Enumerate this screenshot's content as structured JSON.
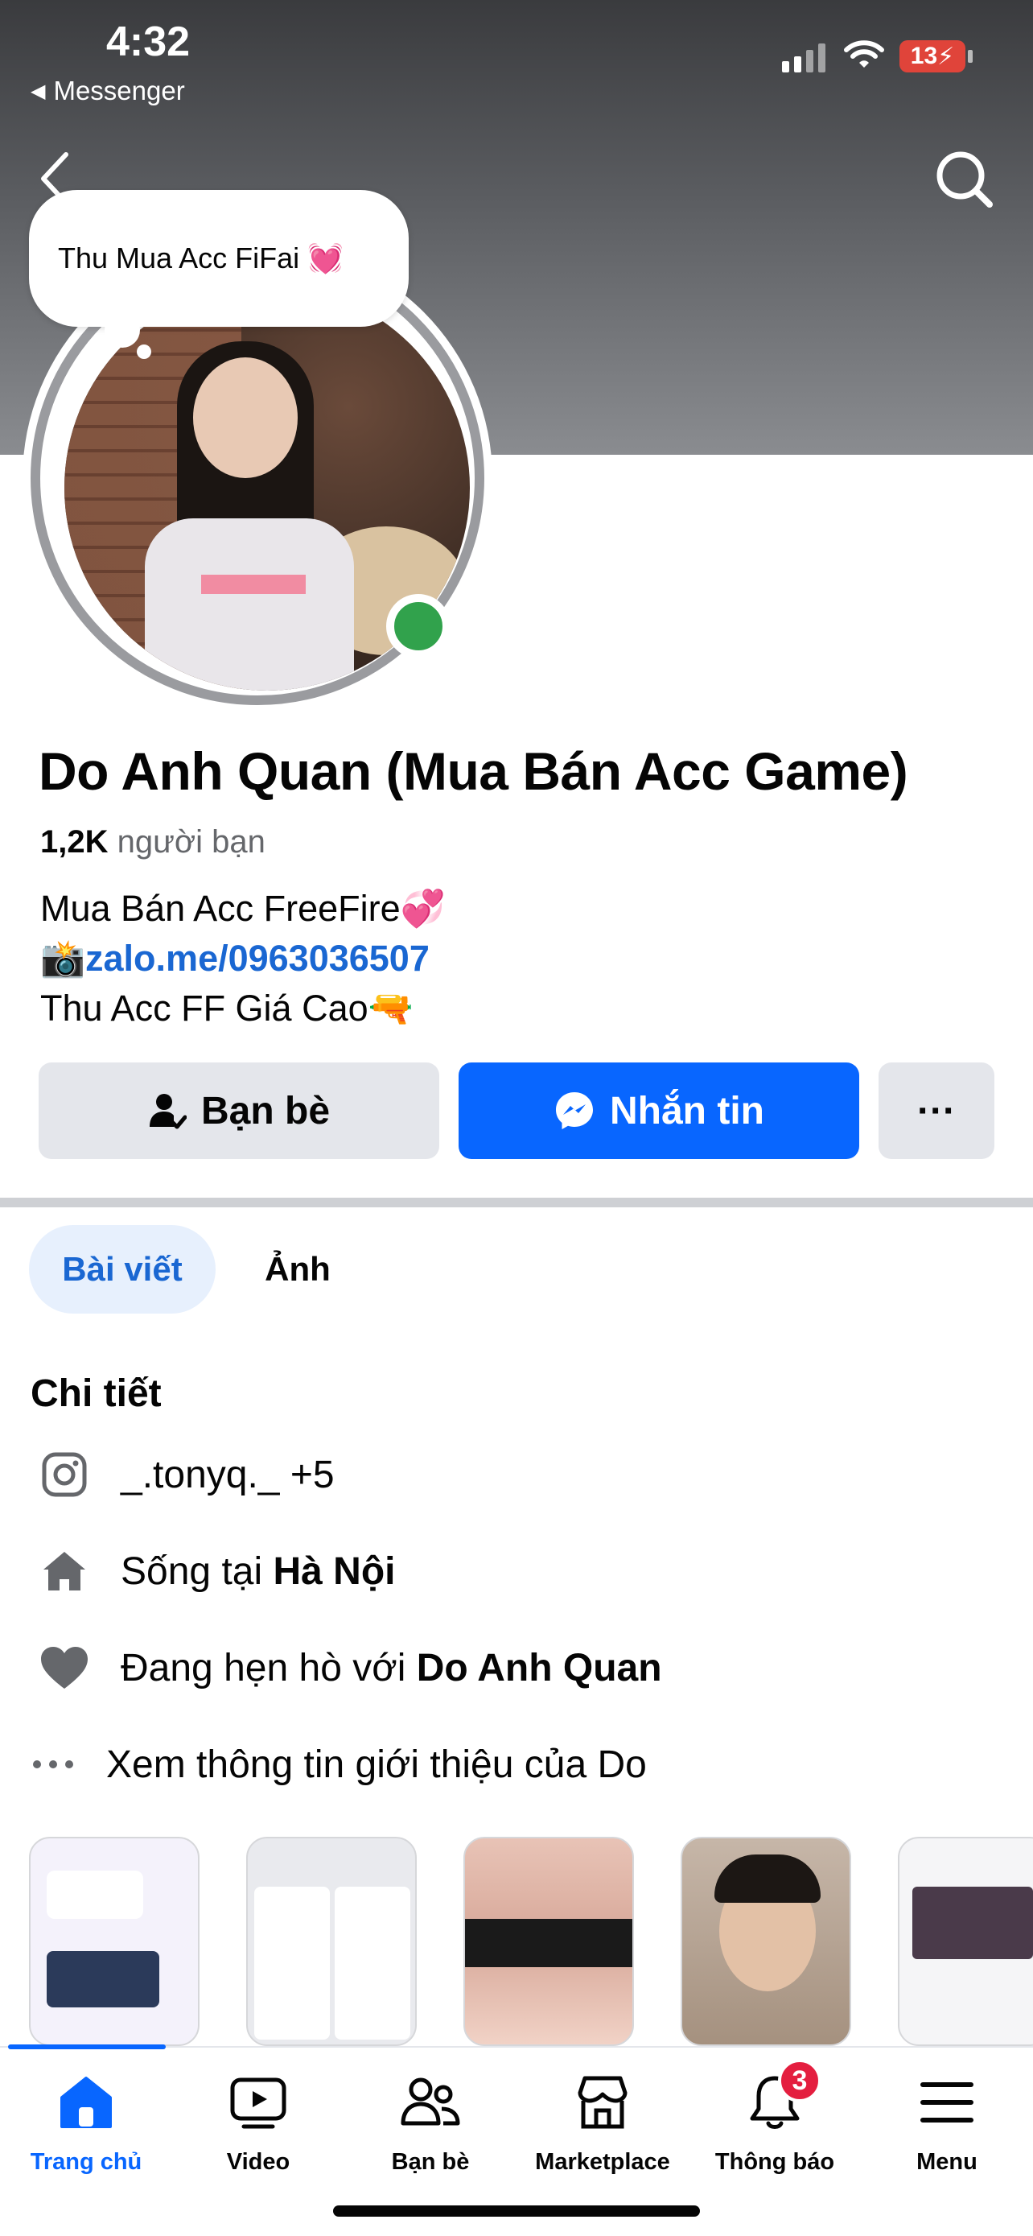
{
  "status_bar": {
    "time": "4:32",
    "back_app": "Messenger",
    "battery": "13"
  },
  "note": {
    "text": "Thu Mua Acc FiFai 💓"
  },
  "profile": {
    "name": "Do Anh Quan (Mua Bán Acc Game)",
    "friends_count": "1,2K",
    "friends_label": "người bạn",
    "bio_line1": "Mua Bán Acc FreeFire💞",
    "bio_line2_emoji": "📸",
    "bio_link": "zalo.me/0963036507",
    "bio_line3": "Thu Acc FF Giá Cao🔫"
  },
  "actions": {
    "friends_label": "Bạn bè",
    "message_label": "Nhắn tin",
    "more_label": "···"
  },
  "tabs": [
    {
      "label": "Bài viết",
      "active": true
    },
    {
      "label": "Ảnh",
      "active": false
    }
  ],
  "details": {
    "title": "Chi tiết",
    "instagram": "_.tonyq._ +5",
    "lives_prefix": "Sống tại",
    "lives_city": "Hà Nội",
    "dating_prefix": "Đang hẹn hò với",
    "dating_name": "Do Anh Quan",
    "see_more": "Xem thông tin giới thiệu của Do"
  },
  "bottom_nav": [
    {
      "label": "Trang chủ",
      "icon": "home-icon",
      "active": true
    },
    {
      "label": "Video",
      "icon": "video-icon"
    },
    {
      "label": "Bạn bè",
      "icon": "friends-icon"
    },
    {
      "label": "Marketplace",
      "icon": "marketplace-icon"
    },
    {
      "label": "Thông báo",
      "icon": "bell-icon",
      "badge": "3"
    },
    {
      "label": "Menu",
      "icon": "menu-icon"
    }
  ],
  "colors": {
    "accent": "#0866ff",
    "link": "#1a67d2",
    "online": "#31a24c",
    "badge": "#e41e3f"
  }
}
